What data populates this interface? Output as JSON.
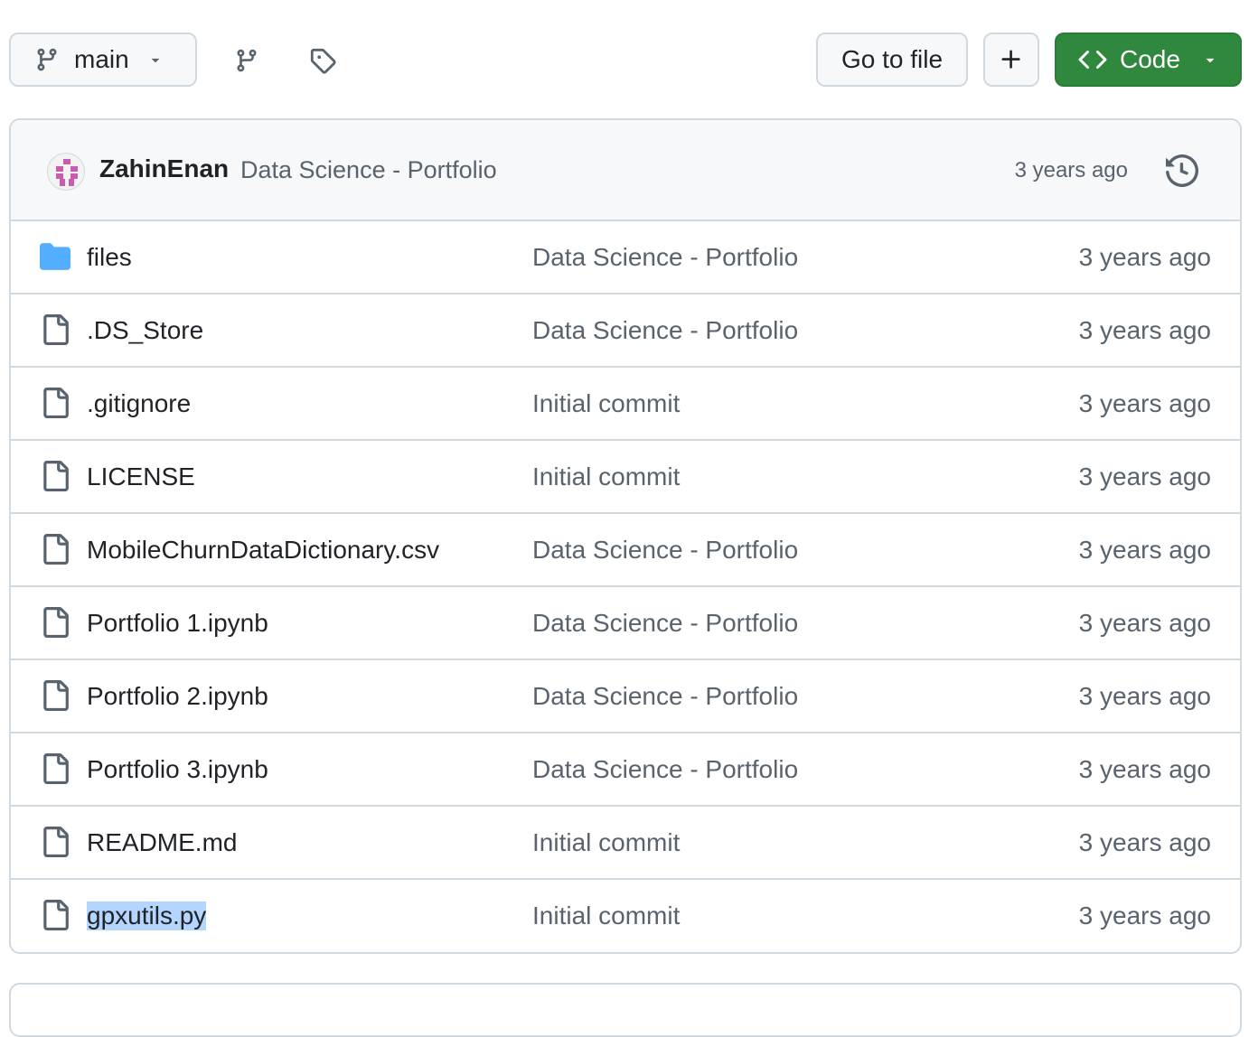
{
  "toolbar": {
    "branch_label": "main",
    "goto_label": "Go to file",
    "add_label": "+",
    "code_label": "Code"
  },
  "colors": {
    "code_button_bg": "#2f883d",
    "folder_icon": "#54aeff",
    "muted_text": "#59636e",
    "border": "#d1d9e0",
    "selection": "#b4d5fe"
  },
  "latest_commit": {
    "author": "ZahinEnan",
    "message": "Data Science - Portfolio",
    "time": "3 years ago"
  },
  "files": [
    {
      "name": "files",
      "type": "folder",
      "message": "Data Science - Portfolio",
      "time": "3 years ago"
    },
    {
      "name": ".DS_Store",
      "type": "file",
      "message": "Data Science - Portfolio",
      "time": "3 years ago"
    },
    {
      "name": ".gitignore",
      "type": "file",
      "message": "Initial commit",
      "time": "3 years ago"
    },
    {
      "name": "LICENSE",
      "type": "file",
      "message": "Initial commit",
      "time": "3 years ago"
    },
    {
      "name": "MobileChurnDataDictionary.csv",
      "type": "file",
      "message": "Data Science - Portfolio",
      "time": "3 years ago"
    },
    {
      "name": "Portfolio 1.ipynb",
      "type": "file",
      "message": "Data Science - Portfolio",
      "time": "3 years ago"
    },
    {
      "name": "Portfolio 2.ipynb",
      "type": "file",
      "message": "Data Science - Portfolio",
      "time": "3 years ago"
    },
    {
      "name": "Portfolio 3.ipynb",
      "type": "file",
      "message": "Data Science - Portfolio",
      "time": "3 years ago"
    },
    {
      "name": "README.md",
      "type": "file",
      "message": "Initial commit",
      "time": "3 years ago"
    },
    {
      "name": "gpxutils.py",
      "type": "file",
      "message": "Initial commit",
      "time": "3 years ago",
      "selected": true
    }
  ]
}
